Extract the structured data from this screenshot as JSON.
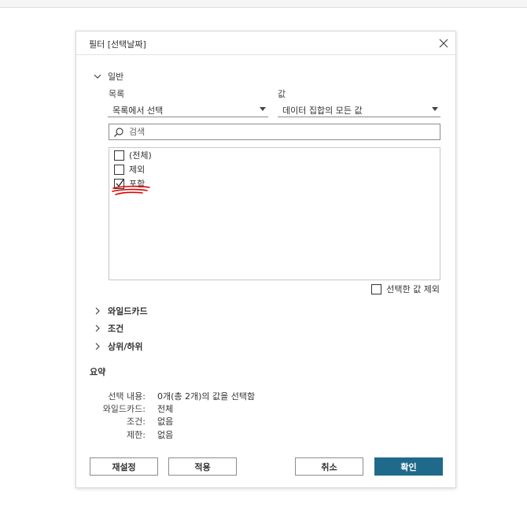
{
  "dialog": {
    "title": "필터 [선택날짜]",
    "close_icon": "close-icon"
  },
  "general": {
    "label": "일반",
    "list_label": "목록",
    "value_label": "값",
    "list_dropdown": "목록에서 선택",
    "value_dropdown": "데이터 집합의 모든 값",
    "search_placeholder": "검색",
    "items": [
      {
        "label": "(전체)",
        "checked": false
      },
      {
        "label": "제외",
        "checked": false
      },
      {
        "label": "포함",
        "checked": true
      }
    ],
    "exclude_selected": "선택한 값 제외"
  },
  "sections": {
    "wildcard": "와일드카드",
    "condition": "조건",
    "topn": "상위/하위"
  },
  "summary": {
    "title": "요약",
    "rows": [
      {
        "key": "선택 내용:",
        "value": "0개(총 2개)의 값을 선택함"
      },
      {
        "key": "와일드카드:",
        "value": "전체"
      },
      {
        "key": "조건:",
        "value": "없음"
      },
      {
        "key": "제한:",
        "value": "없음"
      }
    ]
  },
  "buttons": {
    "reset": "재설정",
    "apply": "적용",
    "cancel": "취소",
    "ok": "확인"
  },
  "colors": {
    "primary": "#1f6a8a",
    "annotation": "#e00000"
  }
}
